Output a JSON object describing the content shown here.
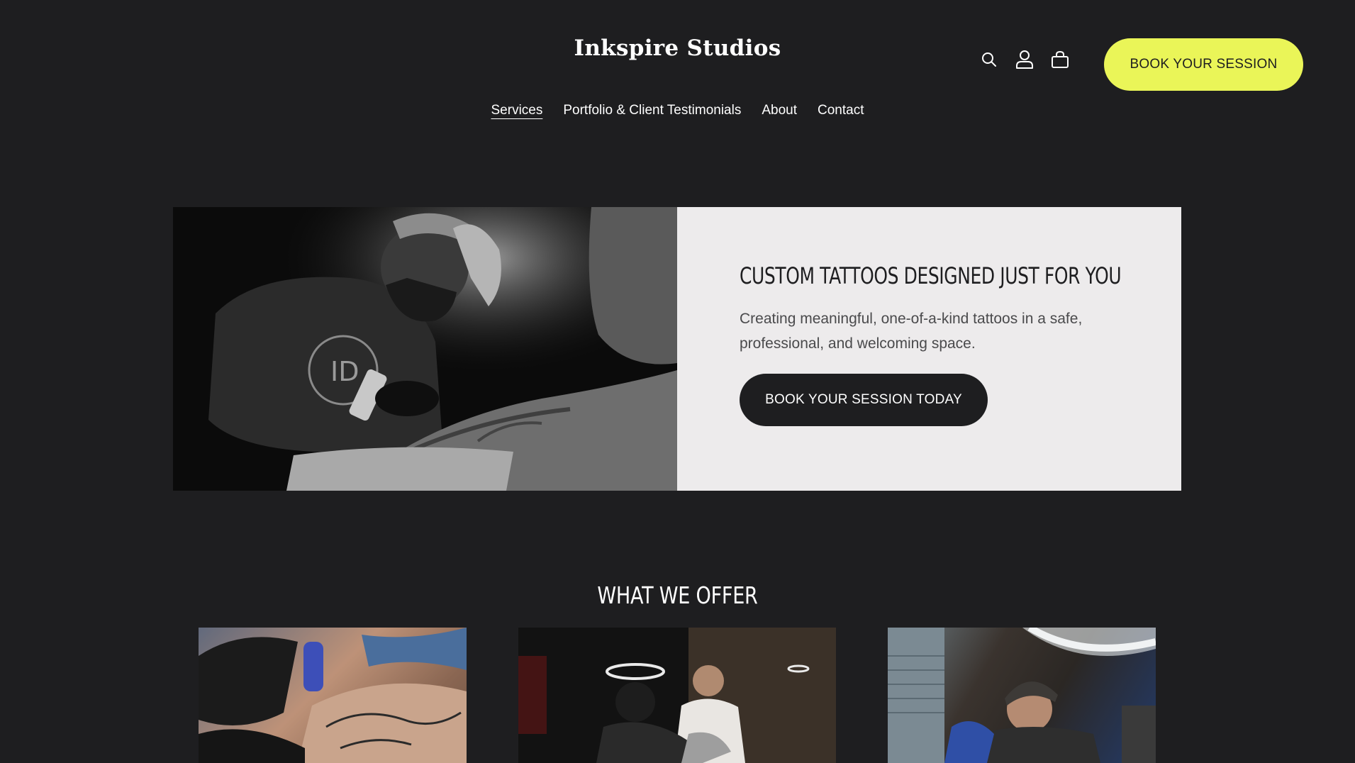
{
  "brand": "Inkspire Studios",
  "nav": {
    "items": [
      {
        "label": "Services",
        "active": true
      },
      {
        "label": "Portfolio & Client Testimonials",
        "active": false
      },
      {
        "label": "About",
        "active": false
      },
      {
        "label": "Contact",
        "active": false
      }
    ]
  },
  "header_icons": [
    "search-icon",
    "account-icon",
    "cart-icon"
  ],
  "header_cta": "BOOK YOUR SESSION",
  "hero": {
    "image_alt": "Tattoo artist working on a client's arm",
    "title": "CUSTOM TATTOOS DESIGNED JUST FOR YOU",
    "text": "Creating meaningful, one-of-a-kind tattoos in a safe, professional, and welcoming space.",
    "button": "BOOK YOUR SESSION TODAY"
  },
  "offer": {
    "title": "WHAT WE OFFER",
    "cards": [
      {
        "image_alt": "Gloved hands tattooing a detailed design"
      },
      {
        "image_alt": "Client seated in the studio during a session"
      },
      {
        "image_alt": "Smiling artist tattooing under a ring light"
      }
    ]
  },
  "colors": {
    "background": "#1e1e20",
    "accent": "#eaf558",
    "panel": "#edebec",
    "button_dark": "#1e1e20"
  }
}
